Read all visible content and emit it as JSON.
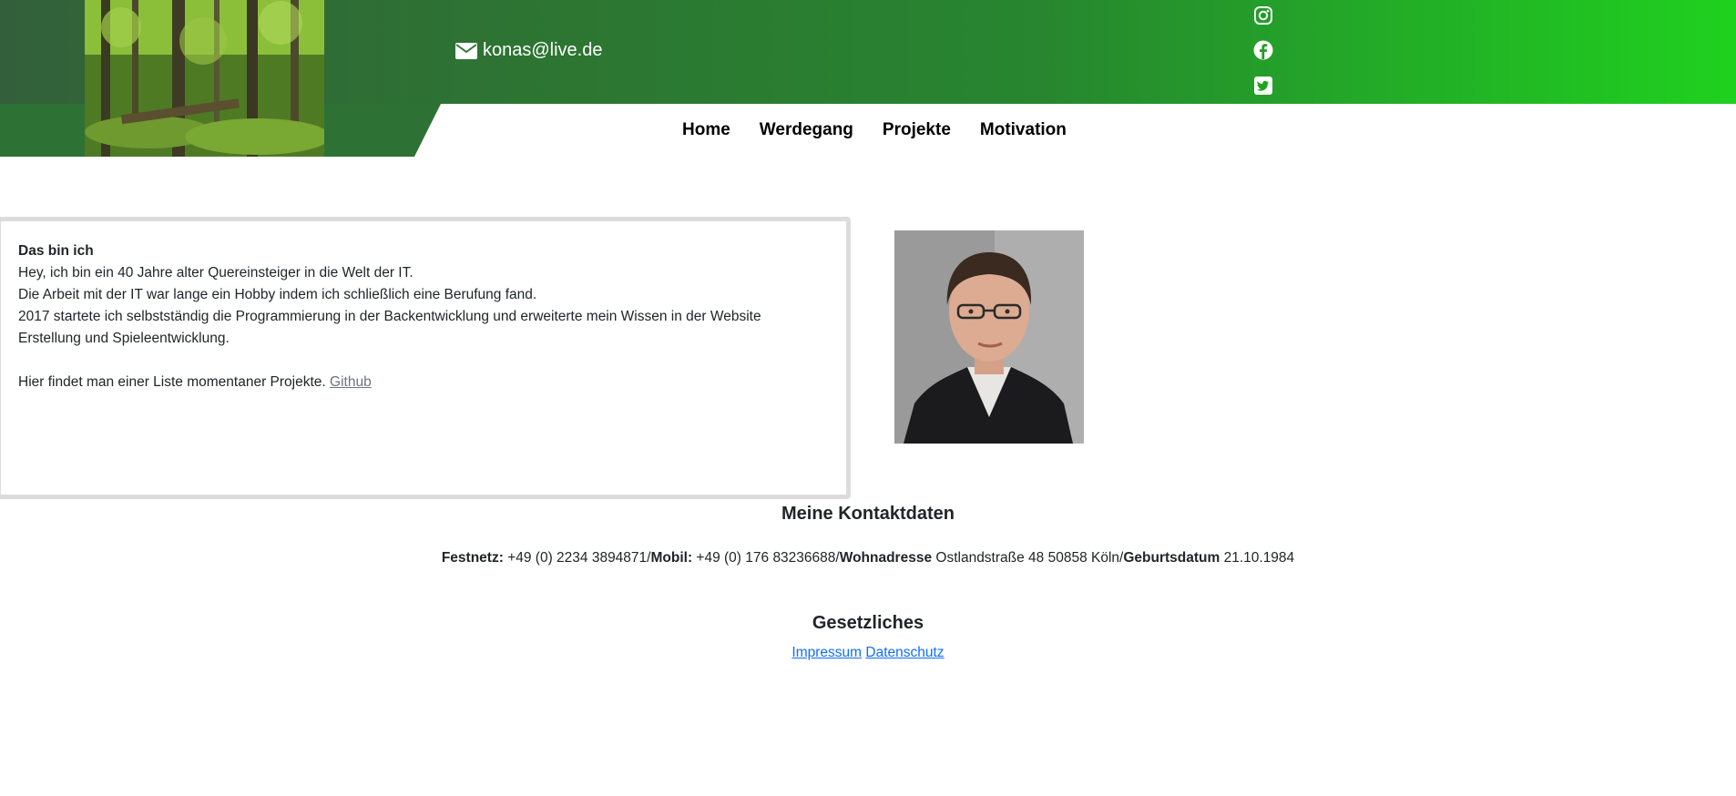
{
  "header": {
    "email": "konas@live.de",
    "social": [
      "instagram-icon",
      "facebook-icon",
      "twitter-icon"
    ],
    "colors": {
      "gradient_start": "#33603a",
      "gradient_end": "#1fd11f"
    }
  },
  "nav": {
    "items": [
      {
        "label": "Home"
      },
      {
        "label": "Werdegang"
      },
      {
        "label": "Projekte"
      },
      {
        "label": "Motivation"
      }
    ]
  },
  "about": {
    "heading": "Das bin ich",
    "lines": [
      "Hey, ich bin ein 40 Jahre alter Quereinsteiger in die Welt der IT.",
      "Die Arbeit mit der IT war lange ein Hobby indem ich schließlich eine Berufung fand.",
      "2017 startete ich selbstständig die Programmierung in der Backentwicklung und erweiterte mein Wissen in der Website Erstellung und Spieleentwicklung."
    ],
    "projects_text": "Hier findet man einer Liste momentaner Projekte.",
    "projects_link": "Github"
  },
  "contact": {
    "title": "Meine Kontaktdaten",
    "landline_label": "Festnetz:",
    "landline": "+49 (0) 2234 3894871",
    "mobile_label": "Mobil:",
    "mobile": "+49 (0) 176 83236688",
    "address_label": "Wohnadresse",
    "address": "Ostlandstraße 48 50858 Köln",
    "birthday_label": "Geburtsdatum",
    "birthday": "21.10.1984",
    "separator": "/"
  },
  "legal": {
    "title": "Gesetzliches",
    "links": [
      "Impressum",
      "Datenschutz"
    ]
  }
}
